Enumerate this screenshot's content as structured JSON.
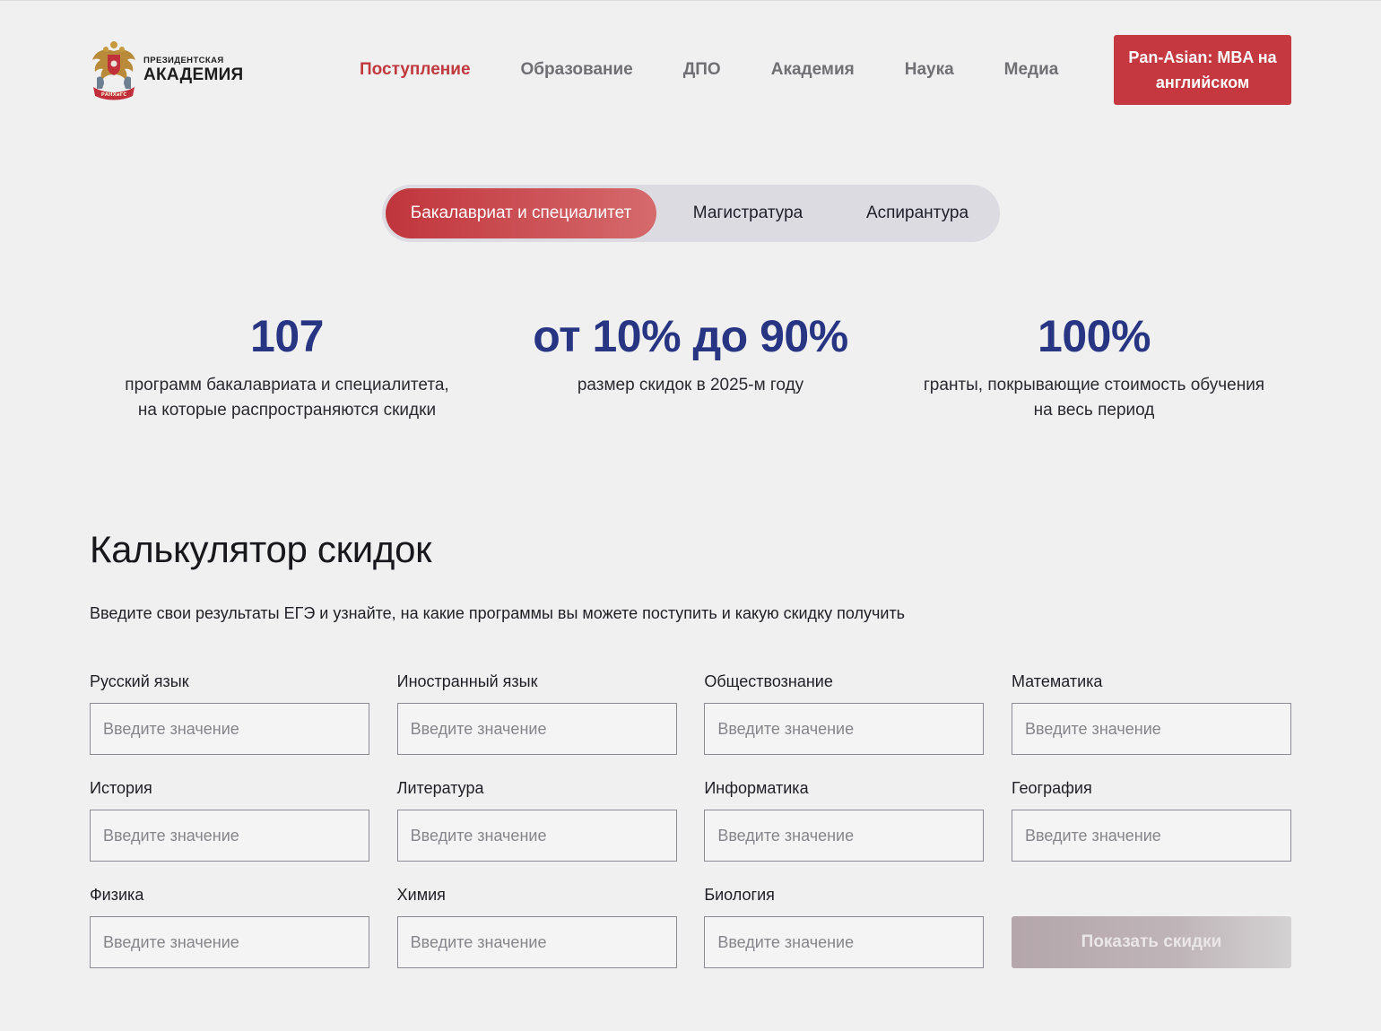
{
  "header": {
    "logo": {
      "line1": "ПРЕЗИДЕНТСКАЯ",
      "line2": "АКАДЕМИЯ",
      "icon": "coat-of-arms-emblem",
      "ribbon_text": "РАНХиГС"
    },
    "nav": [
      {
        "label": "Поступление",
        "active": true
      },
      {
        "label": "Образование",
        "active": false
      },
      {
        "label": "ДПО",
        "active": false
      },
      {
        "label": "Академия",
        "active": false
      },
      {
        "label": "Наука",
        "active": false
      },
      {
        "label": "Медиа",
        "active": false
      }
    ],
    "cta_label": "Pan-Asian: MBA на\nанглийском"
  },
  "tabs": [
    {
      "label": "Бакалавриат и специалитет",
      "active": true
    },
    {
      "label": "Магистратура",
      "active": false
    },
    {
      "label": "Аспирантура",
      "active": false
    }
  ],
  "stats": [
    {
      "value": "107",
      "caption": "программ бакалавриата и специалитета,\nна которые распространяются скидки"
    },
    {
      "value": "от 10% до 90%",
      "caption": "размер скидок в 2025-м году"
    },
    {
      "value": "100%",
      "caption": "гранты, покрывающие стоимость обучения\nна весь период"
    }
  ],
  "calculator": {
    "title": "Калькулятор скидок",
    "subtitle": "Введите свои результаты ЕГЭ и узнайте, на какие программы вы можете поступить и какую скидку получить",
    "placeholder": "Введите значение",
    "fields": [
      {
        "label": "Русский язык",
        "value": ""
      },
      {
        "label": "Иностранный язык",
        "value": ""
      },
      {
        "label": "Обществознание",
        "value": ""
      },
      {
        "label": "Математика",
        "value": ""
      },
      {
        "label": "История",
        "value": ""
      },
      {
        "label": "Литература",
        "value": ""
      },
      {
        "label": "Информатика",
        "value": ""
      },
      {
        "label": "География",
        "value": ""
      },
      {
        "label": "Физика",
        "value": ""
      },
      {
        "label": "Химия",
        "value": ""
      },
      {
        "label": "Биология",
        "value": ""
      }
    ],
    "submit_label": "Показать скидки",
    "submit_enabled": false
  },
  "colors": {
    "background": "#f0f0f0",
    "accent": "#c5383f",
    "stat_blue": "#283583",
    "nav_inactive": "#6f6f74",
    "tab_track": "#dcdbe1",
    "disabled_button": "#bfb5b8"
  }
}
